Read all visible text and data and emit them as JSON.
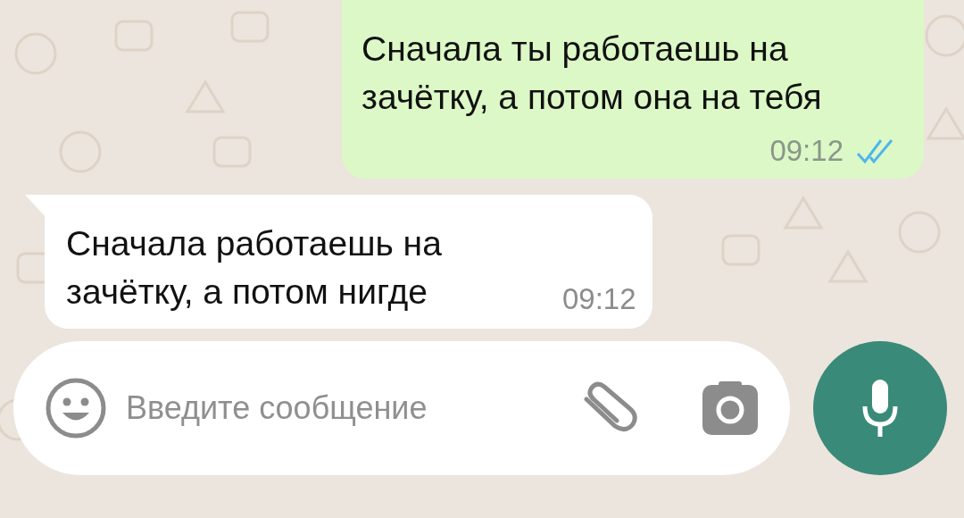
{
  "messages": [
    {
      "kind": "outgoing",
      "text": "Сначала ты работаешь на зачётку, а потом она на тебя",
      "time": "09:12",
      "read": true
    },
    {
      "kind": "incoming",
      "text": "Сначала работаешь на зачётку, а потом нигде",
      "time": "09:12"
    }
  ],
  "composer": {
    "placeholder": "Введите сообщение"
  }
}
